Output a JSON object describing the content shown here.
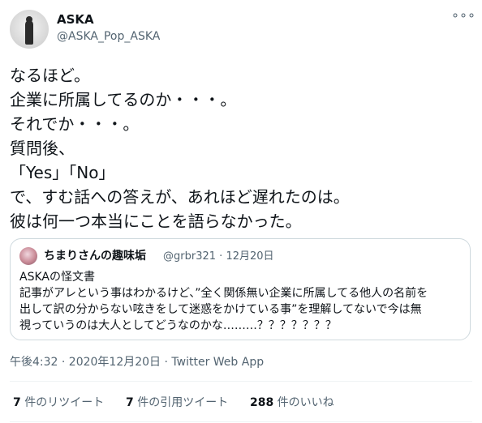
{
  "author": {
    "display_name": "ASKA",
    "handle": "@ASKA_Pop_ASKA",
    "avatar_icon": "avatar-silhouette"
  },
  "menu_icon": "more-dots-icon",
  "more_label": "∘∘∘",
  "tweet_text": "なるほど。\n企業に所属してるのか・・・。\nそれでか・・・。\n質問後、\n「Yes」「No」\nで、すむ話への答えが、あれほど遅れたのは。\n彼は何一つ本当にことを語らなかった。",
  "quoted": {
    "display_name": "ちまりさんの趣味垢",
    "handle": "@grbr321",
    "separator": "·",
    "date": "12月20日",
    "text": "ASKAの怪文書\n記事がアレという事はわかるけど、”全く関係無い企業に所属してる他人の名前を\n出して訳の分からない呟きをして迷惑をかけている事”を理解してないで今は無\n視っていうのは大人としてどうなのかな………？？？？？？？"
  },
  "timestamp": "午後4:32 · 2020年12月20日 · Twitter Web App",
  "stats": {
    "retweets_count": "7",
    "retweets_label": " 件のリツイート",
    "quotes_count": "7",
    "quotes_label": " 件の引用ツイート",
    "likes_count": "288",
    "likes_label": " 件のいいね"
  },
  "colors": {
    "text": "#0f1419",
    "secondary": "#536471",
    "border": "#cfd9de",
    "divider": "#eff3f4"
  }
}
